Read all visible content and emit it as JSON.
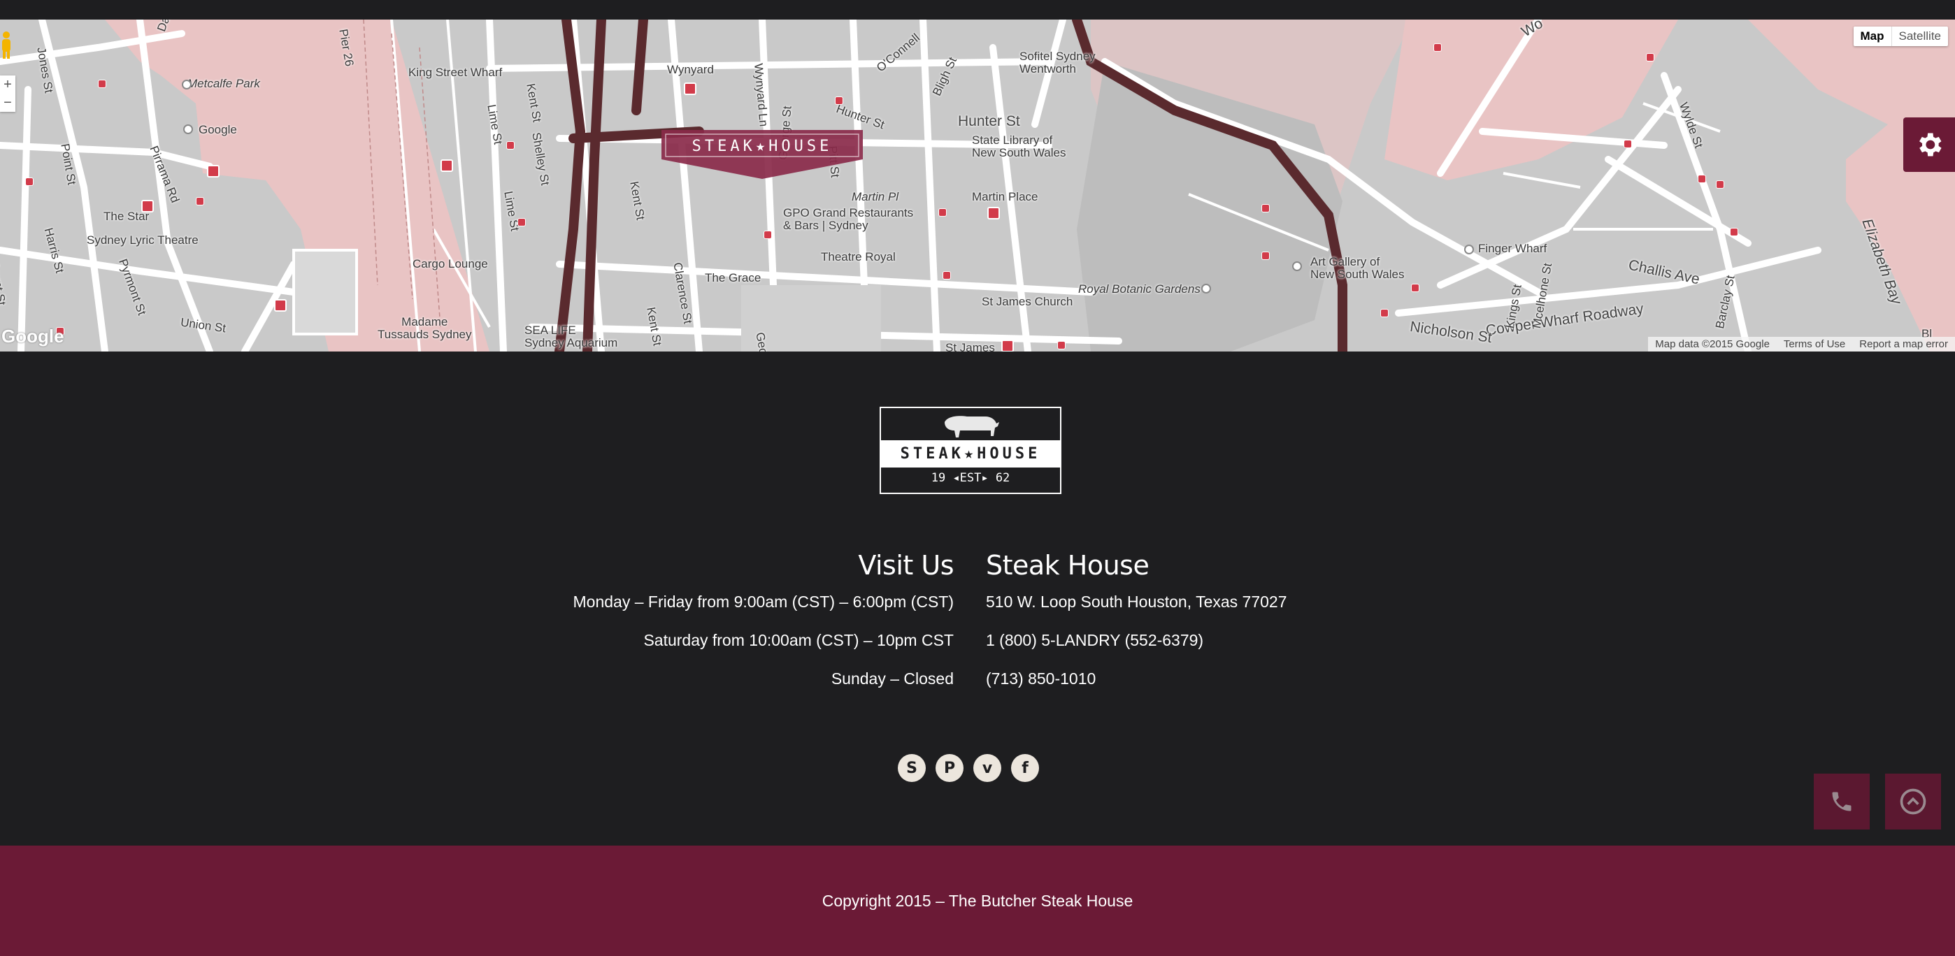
{
  "map": {
    "type_buttons": [
      "Map",
      "Satellite"
    ],
    "zoom": {
      "in": "+",
      "out": "−"
    },
    "google_label": "Google",
    "attribution": [
      "Map data ©2015 Google",
      "Terms of Use",
      "Report a map error"
    ],
    "marker_logo_text": "STEAK★HOUSE",
    "labels": {
      "metcalfe": "Metcalfe Park",
      "google": "Google",
      "king_wharf": "King Street Wharf",
      "lime_st": "Lime St",
      "lime_st2": "Lime St",
      "shelley": "Shelley St",
      "kent_st": "Kent St",
      "kent_st2": "Kent St",
      "kent_st3": "Kent St",
      "wynyard": "Wynyard",
      "wynyard_ln": "Wynyard Ln",
      "oconnell": "O'Connell",
      "sofitel": "Sofitel Sydney\nWentworth",
      "bligh": "Bligh St",
      "hunter_st": "Hunter St",
      "hunter_st2": "Hunter St",
      "state_library": "State Library of\nNew South Wales",
      "martin_pl": "Martin Pl",
      "martin_place": "Martin Place",
      "gpo": "GPO Grand Restaurants\n& Bars | Sydney",
      "theatre_royal": "Theatre Royal",
      "st_james_church": "St James Church",
      "st_james": "St James",
      "the_grace": "The Grace",
      "clarence": "Clarence St",
      "pitt": "Pitt St",
      "george": "George St",
      "george2": "Georg",
      "cargo": "Cargo Lounge",
      "the_star": "The Star",
      "lyric": "Sydney Lyric Theatre",
      "pirrama": "Pirrama Rd",
      "point_st": "Point St",
      "harris": "Harris St",
      "pyrmont": "Pyrmont St",
      "union": "Union St",
      "madame": "Madame\nTussauds Sydney",
      "sealife": "SEA LIFE\nSydney Aquarium",
      "royal_botanic": "Royal Botanic Gardens",
      "art_gallery": "Art Gallery of\nNew South Wales",
      "finger_wharf": "Finger Wharf",
      "cowper": "Cowper Wharf Roadway",
      "challis": "Challis Ave",
      "nicholson": "Nicholson St",
      "elizabeth_bay": "Elizabeth Bay",
      "wylde": "Wylde St",
      "darling": "Darling Isl",
      "pier26": "Pier 26",
      "mount": "Mount St",
      "jones": "Jones St",
      "wo": "Wo",
      "mcelhone": "Mcelhone St",
      "kings": "Kings St",
      "barclay": "Barclay St",
      "bl": "Bl"
    }
  },
  "footer": {
    "logo": {
      "name": "STEAK★HOUSE",
      "est": "19 ◂EST▸ 62"
    },
    "visit": {
      "heading": "Visit Us",
      "lines": [
        "Monday – Friday from 9:00am (CST) – 6:00pm (CST)",
        "Saturday from 10:00am (CST) – 10pm CST",
        "Sunday – Closed"
      ]
    },
    "contact": {
      "heading": "Steak House",
      "lines": [
        "510 W. Loop South Houston, Texas 77027",
        "1 (800) 5-LANDRY (552-6379)",
        "(713) 850-1010"
      ]
    },
    "socials": [
      {
        "icon": "skype-icon",
        "glyph": "S"
      },
      {
        "icon": "pinterest-icon",
        "glyph": "P"
      },
      {
        "icon": "vimeo-icon",
        "glyph": "v"
      },
      {
        "icon": "facebook-icon",
        "glyph": "f"
      }
    ]
  },
  "copyright": "Copyright 2015 – The Butcher Steak House",
  "colors": {
    "brand": "#6b1a36",
    "dark": "#1e1e20",
    "map_water": "#e9c4c4",
    "map_road": "#5a2a2e"
  }
}
